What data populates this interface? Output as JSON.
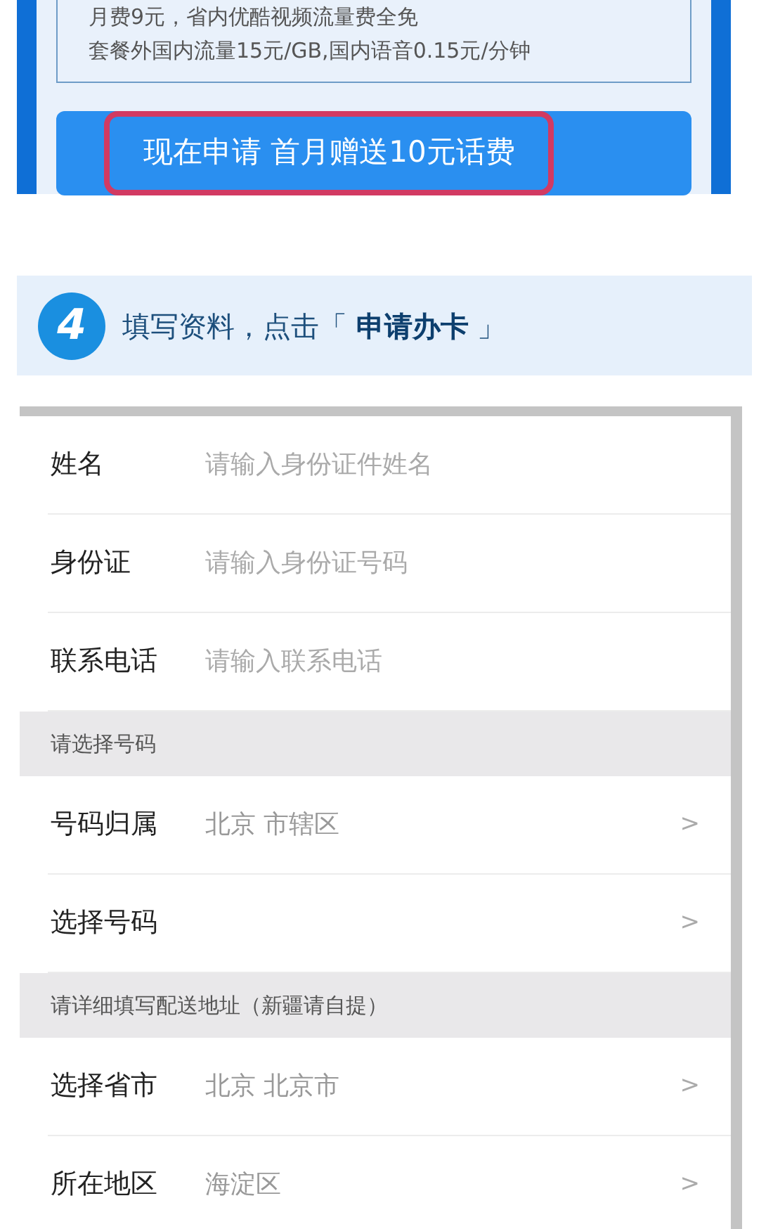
{
  "offer": {
    "lines": [
      "月费9元，省内优酷视频流量费全免",
      "套餐外国内流量15元/GB,国内语音0.15元/分钟"
    ],
    "apply_button": "现在申请 首月赠送10元话费",
    "highlighted": true
  },
  "step": {
    "number": "4",
    "text": "填写资料，点击「 **申请办卡** 」"
  },
  "form": [
    {
      "kind": "input",
      "label": "姓名",
      "placeholder": "请输入身份证件姓名"
    },
    {
      "kind": "input",
      "label": "身份证",
      "placeholder": "请输入身份证号码"
    },
    {
      "kind": "input",
      "label": "联系电话",
      "placeholder": "请输入联系电话"
    },
    {
      "kind": "section",
      "label": "请选择号码"
    },
    {
      "kind": "select",
      "label": "号码归属",
      "value": "北京 市辖区",
      "chevron": ">"
    },
    {
      "kind": "select",
      "label": "选择号码",
      "chevron": ">"
    },
    {
      "kind": "section",
      "label": "请详细填写配送地址（新疆请自提）"
    },
    {
      "kind": "select",
      "label": "选择省市",
      "value": "北京 北京市",
      "chevron": ">"
    },
    {
      "kind": "select",
      "label": "所在地区",
      "value": "海淀区",
      "chevron": ">"
    }
  ]
}
